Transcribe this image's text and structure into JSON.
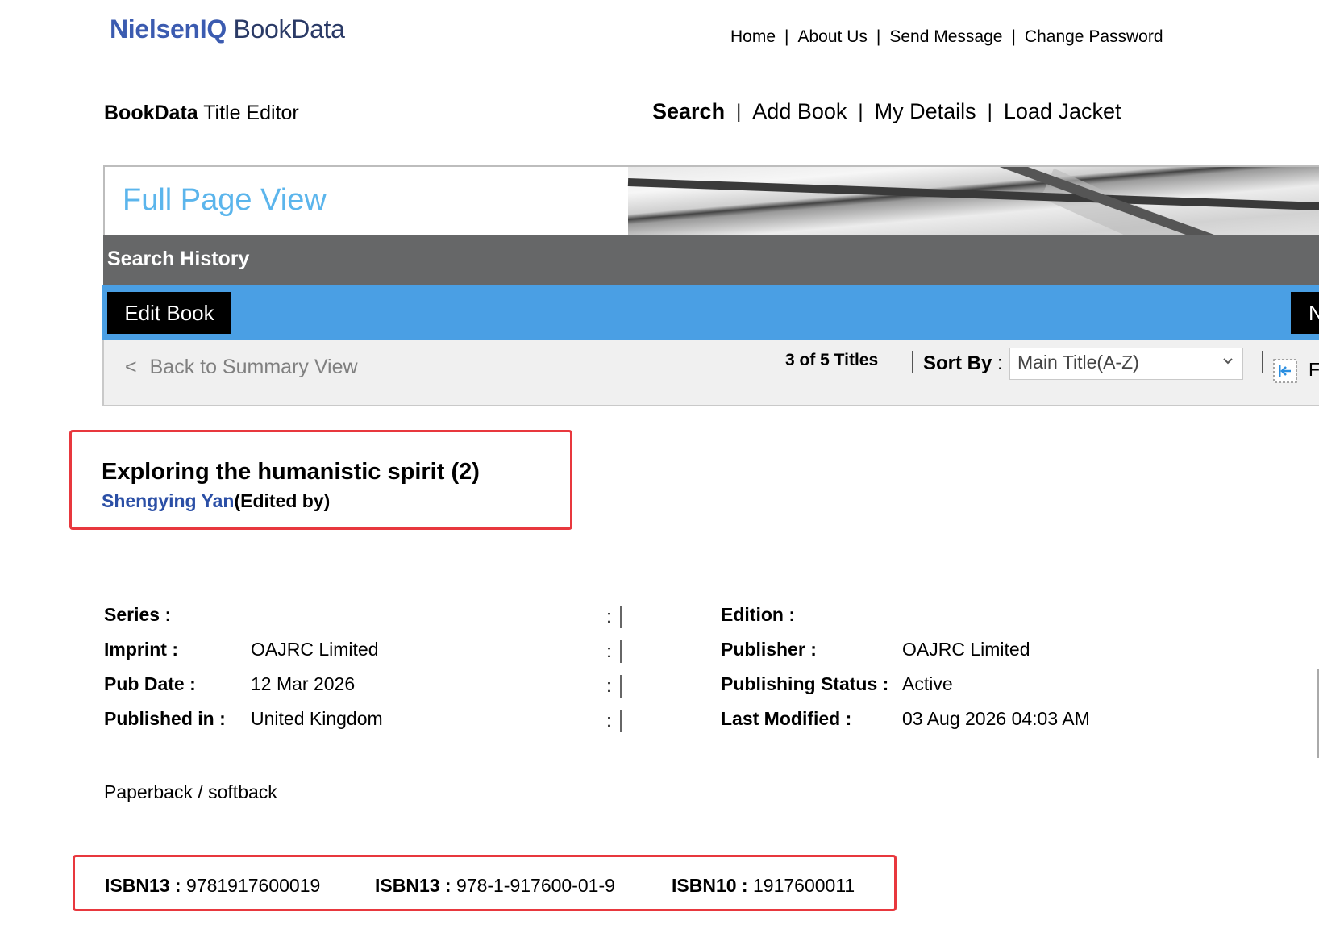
{
  "header": {
    "logo_brand": "NielsenIQ",
    "logo_product": "BookData",
    "top_nav": [
      "Home",
      "About Us",
      "Send Message",
      "Change Password"
    ],
    "app_title_bold": "BookData",
    "app_title_rest": "Title Editor",
    "main_nav": [
      "Search",
      "Add Book",
      "My Details",
      "Load Jacket"
    ],
    "main_nav_active": "Search"
  },
  "banner": {
    "title": "Full Page View"
  },
  "history_bar": {
    "label": "Search History"
  },
  "action_bar": {
    "edit_label": "Edit Book",
    "next_label_partial": "N"
  },
  "nav_bar": {
    "back_chevron": "<",
    "back_label": "Back to Summary View",
    "count": "3 of 5 Titles",
    "sort_label": "Sort By",
    "sort_colon": ":",
    "sort_value": "Main Title(A-Z)",
    "first_label_partial": "F"
  },
  "book": {
    "title": "Exploring the humanistic spirit (2)",
    "author_name": "Shengying Yan",
    "author_role": "(Edited by)"
  },
  "details": {
    "left": [
      {
        "label": "Series :",
        "value": ""
      },
      {
        "label": "Imprint :",
        "value": "OAJRC Limited"
      },
      {
        "label": "Pub Date :",
        "value": "12 Mar 2026"
      },
      {
        "label": "Published in :",
        "value": "United Kingdom"
      }
    ],
    "right": [
      {
        "label": "Edition :",
        "value": ""
      },
      {
        "label": "Publisher :",
        "value": "OAJRC Limited"
      },
      {
        "label": "Publishing Status :",
        "value": "Active"
      },
      {
        "label": "Last Modified :",
        "value": "03 Aug 2026 04:03 AM"
      }
    ],
    "colon": ":"
  },
  "format": "Paperback / softback",
  "isbns": [
    {
      "label": "ISBN13 :",
      "value": "9781917600019"
    },
    {
      "label": "ISBN13 :",
      "value": "978-1-917600-01-9"
    },
    {
      "label": "ISBN10 :",
      "value": "1917600011"
    }
  ],
  "colors": {
    "banner_title": "#5bb5ec",
    "history_bar": "#666768",
    "action_bar": "#4a9fe4",
    "highlight_border": "#e8383e",
    "author_link": "#2b4fa6"
  }
}
